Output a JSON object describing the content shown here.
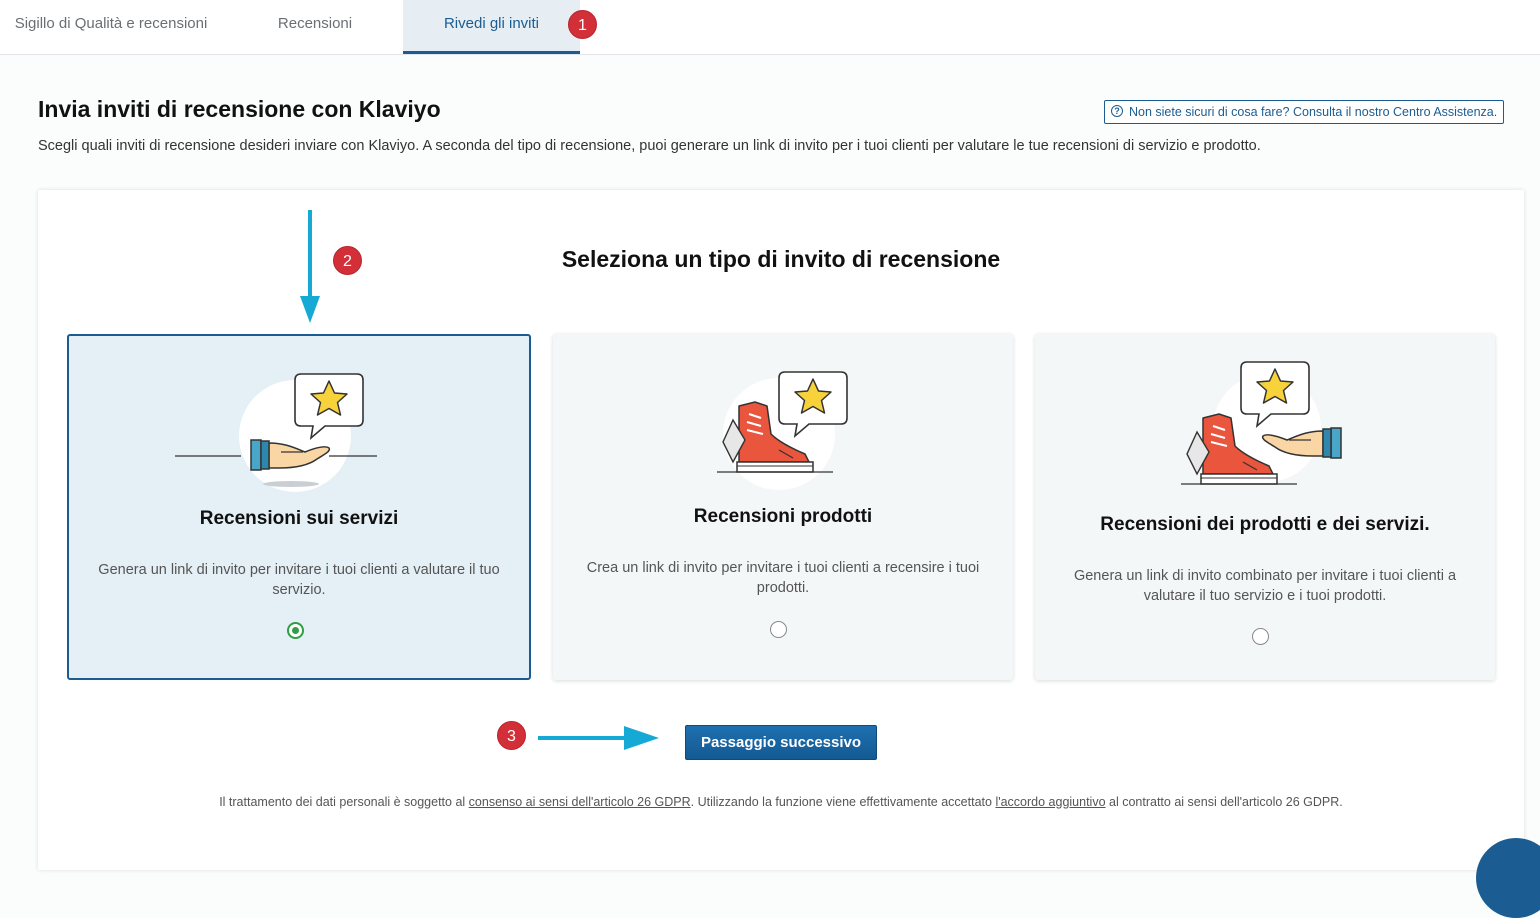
{
  "tabs": [
    {
      "label": "Sigillo di Qualità e recensioni"
    },
    {
      "label": "Recensioni"
    },
    {
      "label": "Rivedi gli inviti",
      "active": true
    }
  ],
  "annotations": {
    "badge1": "1",
    "badge2": "2",
    "badge3": "3",
    "arrow_color": "#16a9d6",
    "badge_color": "#d32f38"
  },
  "header": {
    "title": "Invia inviti di recensione con Klaviyo",
    "help_link": "Non siete sicuri di cosa fare? Consulta il nostro Centro Assistenza.",
    "description": "Scegli quali inviti di recensione desideri inviare con Klaviyo. A seconda del tipo di recensione, puoi generare un link di invito per i tuoi clienti per valutare le tue recensioni di servizio e prodotto."
  },
  "section_title": "Seleziona un tipo di invito di recensione",
  "cards": [
    {
      "title": "Recensioni sui servizi",
      "description": "Genera un link di invito per invitare i tuoi clienti a valutare il tuo servizio.",
      "selected": true,
      "icon": "hand-star-speech-icon"
    },
    {
      "title": "Recensioni prodotti",
      "description": "Crea un link di invito per invitare i tuoi clienti a recensire i tuoi prodotti.",
      "selected": false,
      "icon": "sneaker-star-speech-icon"
    },
    {
      "title": "Recensioni dei prodotti e dei servizi.",
      "description": "Genera un link di invito combinato per invitare i tuoi clienti a valutare il tuo servizio e i tuoi prodotti.",
      "selected": false,
      "icon": "sneaker-hand-star-speech-icon"
    }
  ],
  "next_button": "Passaggio successivo",
  "footer": {
    "part1": "Il trattamento dei dati personali è soggetto al ",
    "link1": "consenso ai sensi dell'articolo 26 GDPR",
    "part2": ". Utilizzando la funzione viene effettivamente accettato ",
    "link2": "l'accordo aggiuntivo",
    "part3": " al contratto ai sensi dell'articolo 26 GDPR."
  },
  "colors": {
    "primary": "#1b5d92",
    "selected_card_bg": "#e4eff6",
    "radio_checked": "#2f9e44",
    "shoe_red": "#e9553d",
    "star_yellow": "#f7d23a"
  }
}
